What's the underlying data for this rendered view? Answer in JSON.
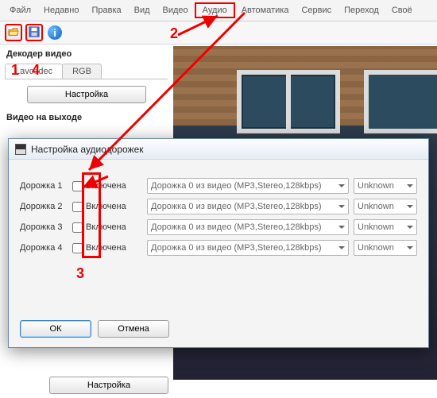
{
  "menu": {
    "items": [
      "Файл",
      "Недавно",
      "Правка",
      "Вид",
      "Видео",
      "Аудио",
      "Автоматика",
      "Сервис",
      "Переход",
      "Своё"
    ],
    "highlight_index": 5
  },
  "toolbar": {
    "open_tip": "Open",
    "save_tip": "Save",
    "info_tip": "Info"
  },
  "left": {
    "decoder_title": "Декодер видео",
    "tabs": [
      "Lavcodec",
      "RGB"
    ],
    "config_btn": "Настройка",
    "output_title": "Видео на выходе",
    "bottom_config_btn": "Настройка"
  },
  "dialog": {
    "title": "Настройка аудиодорожек",
    "tracks": [
      {
        "label": "Дорожка 1",
        "enabled_label": "Включена",
        "src": "Дорожка 0 из видео (MP3,Stereo,128kbps)",
        "lang": "Unknown"
      },
      {
        "label": "Дорожка 2",
        "enabled_label": "Включена",
        "src": "Дорожка 0 из видео (MP3,Stereo,128kbps)",
        "lang": "Unknown"
      },
      {
        "label": "Дорожка 3",
        "enabled_label": "Включена",
        "src": "Дорожка 0 из видео (MP3,Stereo,128kbps)",
        "lang": "Unknown"
      },
      {
        "label": "Дорожка 4",
        "enabled_label": "Включена",
        "src": "Дорожка 0 из видео (MP3,Stereo,128kbps)",
        "lang": "Unknown"
      }
    ],
    "ok": "ОК",
    "cancel": "Отмена"
  },
  "callouts": {
    "c1": "1",
    "c2": "2",
    "c3": "3",
    "c4": "4"
  }
}
